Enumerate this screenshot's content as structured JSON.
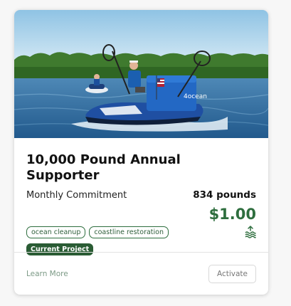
{
  "card": {
    "image_alt": "Jet ski with cleanup nets on water",
    "image_logo_text": "4ocean",
    "title": "10,000 Pound Annual Supporter",
    "subtitle": "Monthly Commitment",
    "amount": "834 pounds",
    "price": "$1.00",
    "tags": [
      "ocean cleanup",
      "coastline restoration"
    ],
    "badge": "Current Project",
    "learn_more": "Learn More",
    "activate": "Activate",
    "icons": {
      "water": "water-waves-icon"
    },
    "colors": {
      "accent_green": "#2e6e3e",
      "badge_bg": "#2a5c34",
      "learn_more": "#7c9a86"
    }
  }
}
